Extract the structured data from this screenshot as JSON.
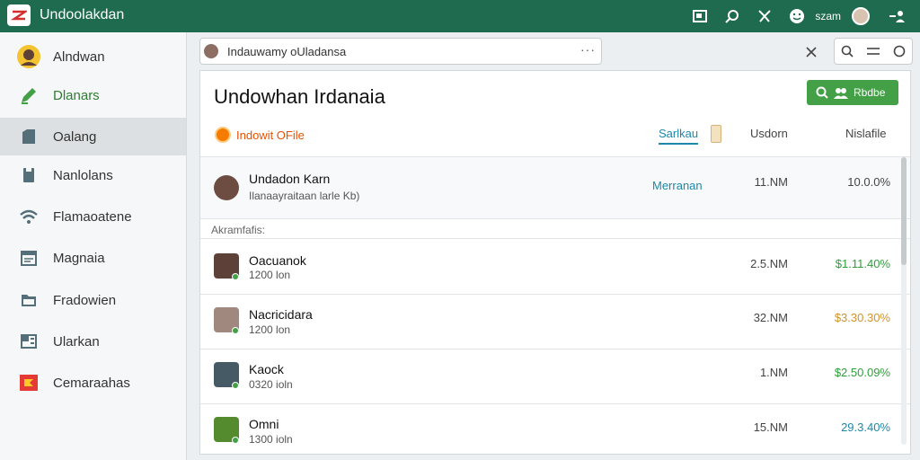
{
  "app": {
    "title": "Undoolakdan"
  },
  "topbar": {
    "username": "szam"
  },
  "sidebar": {
    "items": [
      {
        "label": "Alndwan",
        "icon": "user-avatar-icon"
      },
      {
        "label": "Dlanars",
        "icon": "edit-icon"
      },
      {
        "label": "Oalang",
        "icon": "folder-icon"
      },
      {
        "label": "Nanlolans",
        "icon": "document-icon"
      },
      {
        "label": "Flamaoatene",
        "icon": "wifi-icon"
      },
      {
        "label": "Magnaia",
        "icon": "calendar-icon"
      },
      {
        "label": "Fradowien",
        "icon": "folder-open-icon"
      },
      {
        "label": "Ularkan",
        "icon": "archive-icon"
      },
      {
        "label": "Cemaraahas",
        "icon": "flag-icon"
      }
    ]
  },
  "search": {
    "value": "Indauwamy oUladansa",
    "more": "···"
  },
  "main": {
    "title": "Undowhan Irdanaia",
    "primary_button": "Rbdbe",
    "filter_label": "Indowit OFile",
    "columns": {
      "status": "Sarlkau",
      "size": "Usdorn",
      "progress": "Nislafile"
    },
    "section_label": "Akramfafis:"
  },
  "featured": {
    "name": "Undadon Karn",
    "subtitle": "Ilanaayraitaan larle Kb)",
    "status": "Merranan",
    "size": "11.NM",
    "progress": "10.0.0%"
  },
  "rows": [
    {
      "name": "Oacuanok",
      "sub": "1200 lon",
      "size": "2.5.NM",
      "progress": "$1.11.40%",
      "color": "#2e9e3a"
    },
    {
      "name": "Nacricidara",
      "sub": "1200 lon",
      "size": "32.NM",
      "progress": "$3.30.30%",
      "color": "#d4922a"
    },
    {
      "name": "Kaock",
      "sub": "0320 ioln",
      "size": "1.NM",
      "progress": "$2.50.09%",
      "color": "#2e9e3a"
    },
    {
      "name": "Omni",
      "sub": "1300 ioln",
      "size": "15.NM",
      "progress": "29.3.40%",
      "color": "#1e88a8"
    }
  ],
  "colors": {
    "topbar": "#1e6b50",
    "accent": "#43a047",
    "link": "#1e88a8"
  }
}
